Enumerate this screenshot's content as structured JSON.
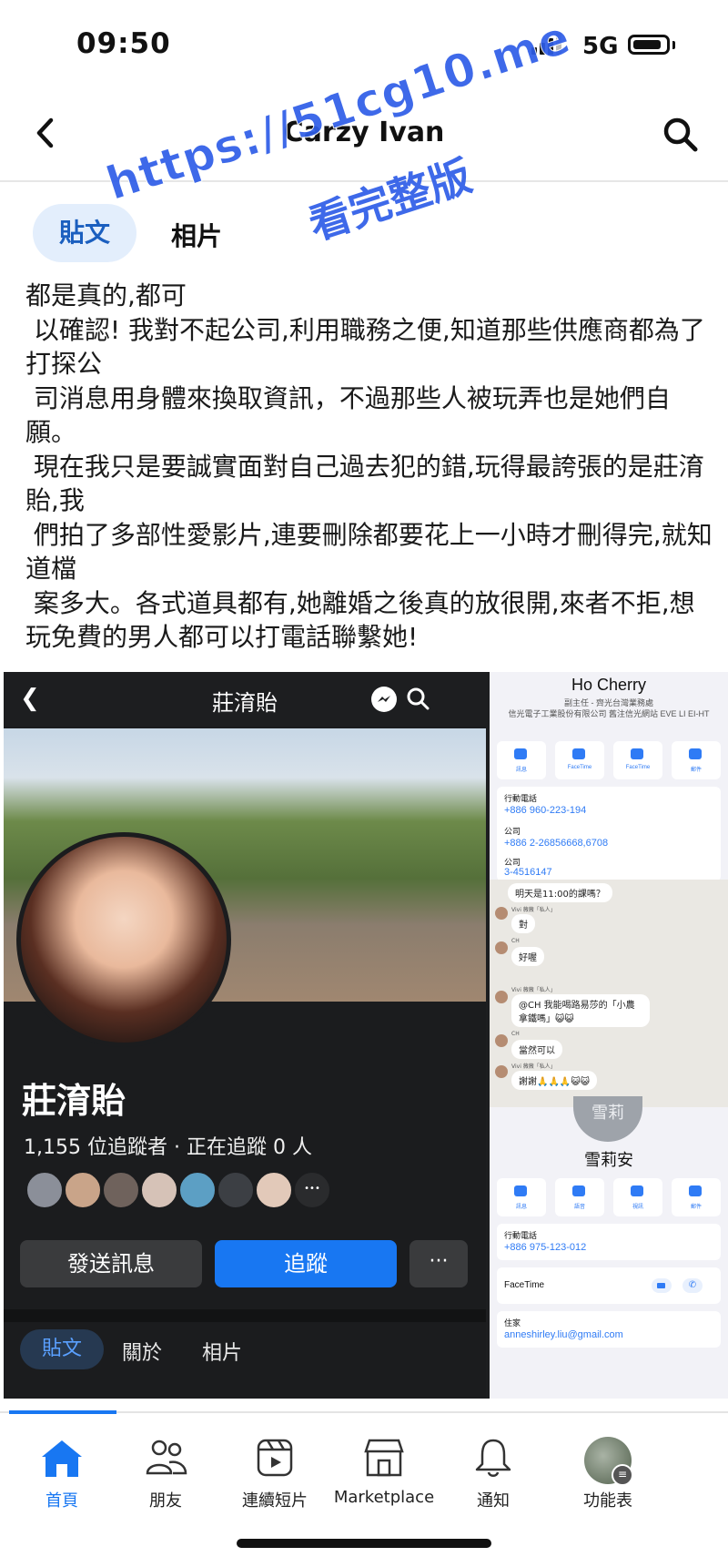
{
  "status_bar": {
    "time": "09:50",
    "network": "5G"
  },
  "nav": {
    "title": "Carzy Ivan"
  },
  "tabs": [
    {
      "label": "貼文",
      "active": true
    },
    {
      "label": "相片",
      "active": false
    }
  ],
  "watermark": {
    "line1": "https://51cg10.me",
    "line2": "看完整版"
  },
  "post": {
    "text": "都是真的,都可\n 以確認! 我對不起公司,利用職務之便,知道那些供應商都為了打探公\n 司消息用身體來換取資訊，不過那些人被玩弄也是她們自願。\n 現在我只是要誠實面對自己過去犯的錯,玩得最誇張的是莊淯貽,我\n 們拍了多部性愛影片,連要刪除都要花上一小時才刪得完,就知道檔\n 案多大。各式道具都有,她離婚之後真的放很開,來者不拒,想玩免費的男人都可以打電話聯繫她!"
  },
  "screenshot_profile": {
    "top_name": "莊淯貽",
    "name": "莊淯貽",
    "followers": "1,155 位追蹤者 · 正在追蹤 0 人",
    "more_friends": "•••",
    "buttons": {
      "message": "發送訊息",
      "follow": "追蹤",
      "more": "···"
    },
    "tabs": [
      "貼文",
      "關於",
      "相片"
    ]
  },
  "screenshot_contact1": {
    "name": "Ho Cherry",
    "subtitle": "副主任 - 齊光台灣業務處\n信光電子工業股份有限公司 舊注信光網站 EVE LI EI-HT",
    "actions": [
      "訊息",
      "FaceTime",
      "FaceTime",
      "郵件"
    ],
    "fields": [
      {
        "label": "行動電話",
        "value": "+886 960-223-194"
      },
      {
        "label": "公司",
        "value": "+886 2-26856668,6708"
      },
      {
        "label": "公司",
        "value": "3-4516147"
      }
    ]
  },
  "screenshot_chat": {
    "messages": [
      {
        "sender": "",
        "text": "明天是11:00的課嗎？"
      },
      {
        "sender": "Vivi 薇薇「私人」",
        "text": "對"
      },
      {
        "sender": "CH",
        "text": "好喔"
      },
      {
        "sender": "Vivi 薇薇「私人」",
        "text": "@CH 我能喝路易莎的「小農拿鐵嗎」😺😺"
      },
      {
        "sender": "CH",
        "text": "當然可以"
      },
      {
        "sender": "Vivi 薇薇「私人」",
        "text": "謝謝🙏🙏🙏😺😺"
      }
    ]
  },
  "screenshot_contact2": {
    "avatar_text": "雪莉",
    "name": "雪莉安",
    "actions": [
      "訊息",
      "語音",
      "視訊",
      "郵件"
    ],
    "mobile_label": "行動電話",
    "mobile_value": "+886 975-123-012",
    "facetime_label": "FaceTime",
    "home_label": "住家",
    "home_value": "anneshirley.liu@gmail.com"
  },
  "bottom_tabs": [
    {
      "label": "首頁",
      "icon": "home-icon",
      "active": true
    },
    {
      "label": "朋友",
      "icon": "friends-icon",
      "active": false
    },
    {
      "label": "連續短片",
      "icon": "reels-icon",
      "active": false
    },
    {
      "label": "Marketplace",
      "icon": "marketplace-icon",
      "active": false
    },
    {
      "label": "通知",
      "icon": "bell-icon",
      "active": false
    },
    {
      "label": "功能表",
      "icon": "menu-avatar",
      "active": false
    }
  ],
  "colors": {
    "accent": "#1877f2",
    "watermark": "#2e5de8",
    "active_tab_bg": "#e3eefc"
  }
}
